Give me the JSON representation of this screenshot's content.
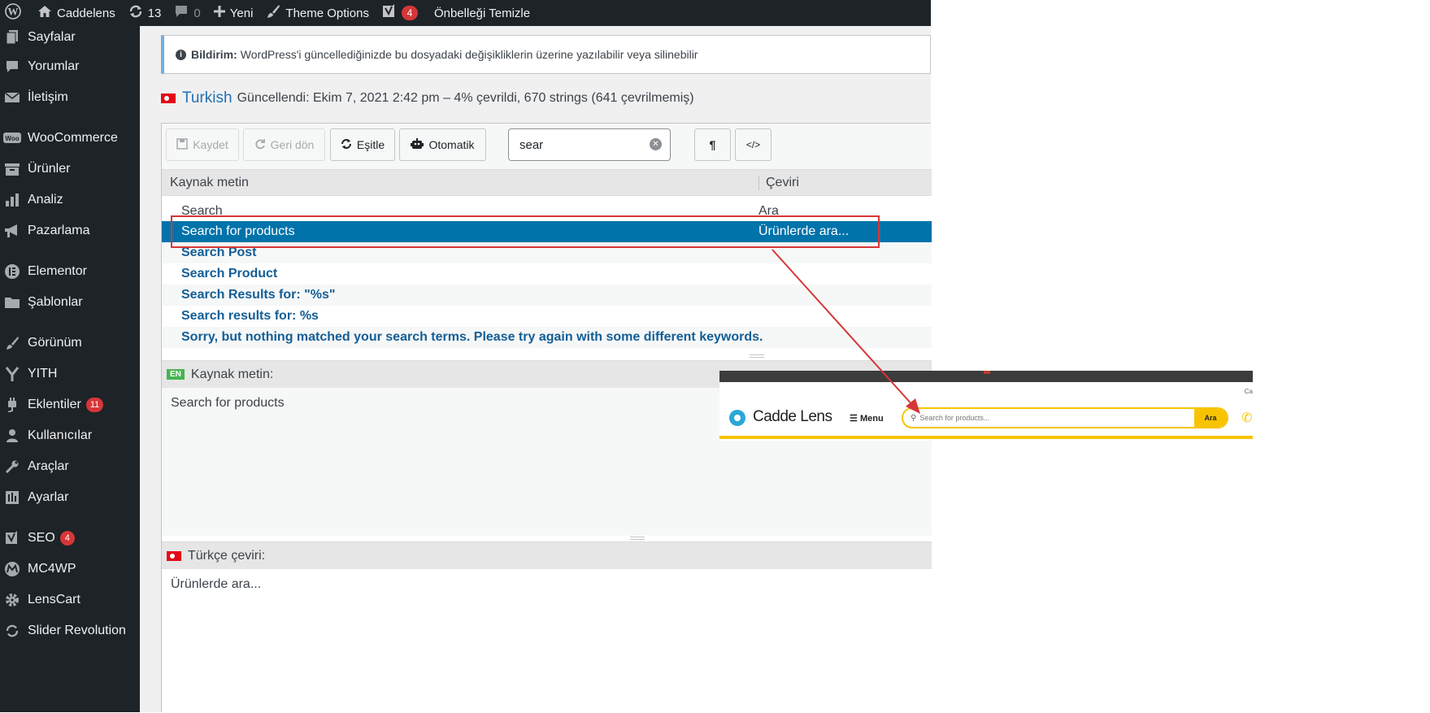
{
  "admin_bar": {
    "site_name": "Caddelens",
    "updates_count": "13",
    "comments_count": "0",
    "new_label": "Yeni",
    "theme_options_label": "Theme Options",
    "yoast_count": "4",
    "clear_cache_label": "Önbelleği Temizle"
  },
  "sidebar": {
    "items": [
      {
        "label": "Sayfalar",
        "icon": "pages-icon"
      },
      {
        "label": "Yorumlar",
        "icon": "comments-icon"
      },
      {
        "label": "İletişim",
        "icon": "mail-icon"
      },
      {
        "label": "WooCommerce",
        "icon": "woocommerce-icon"
      },
      {
        "label": "Ürünler",
        "icon": "archive-icon"
      },
      {
        "label": "Analiz",
        "icon": "bar-chart-icon"
      },
      {
        "label": "Pazarlama",
        "icon": "megaphone-icon"
      },
      {
        "label": "Elementor",
        "icon": "elementor-icon"
      },
      {
        "label": "Şablonlar",
        "icon": "folder-icon"
      },
      {
        "label": "Görünüm",
        "icon": "brush-icon"
      },
      {
        "label": "YITH",
        "icon": "yith-icon"
      },
      {
        "label": "Eklentiler",
        "icon": "plugin-icon",
        "badge": "11"
      },
      {
        "label": "Kullanıcılar",
        "icon": "user-icon"
      },
      {
        "label": "Araçlar",
        "icon": "wrench-icon"
      },
      {
        "label": "Ayarlar",
        "icon": "settings-icon"
      },
      {
        "label": "SEO",
        "icon": "yoast-icon",
        "badge": "4"
      },
      {
        "label": "MC4WP",
        "icon": "mc4wp-icon"
      },
      {
        "label": "LensCart",
        "icon": "gear-icon"
      },
      {
        "label": "Slider Revolution",
        "icon": "refresh-icon"
      }
    ]
  },
  "notice": {
    "title": "Bildirim:",
    "text": "WordPress'i güncellediğinizde bu dosyadaki değişikliklerin üzerine yazılabilir veya silinebilir"
  },
  "language": {
    "name": "Turkish",
    "status": "Güncellendi: Ekim 7, 2021 2:42 pm – 4% çevrildi, 670 strings (641 çevrilmemiş)"
  },
  "toolbar": {
    "save_label": "Kaydet",
    "revert_label": "Geri dön",
    "sync_label": "Eşitle",
    "auto_label": "Otomatik",
    "search_value": "sear",
    "pilcrow": "¶",
    "code_label": "</>"
  },
  "table": {
    "col_source": "Kaynak metin",
    "col_translation": "Çeviri",
    "rows": [
      {
        "source": "Search",
        "translation": "Ara"
      },
      {
        "source": "Search for products",
        "translation": "Ürünlerde ara..."
      },
      {
        "source": "Search Post",
        "translation": ""
      },
      {
        "source": "Search Product",
        "translation": ""
      },
      {
        "source": "Search Results for: \"%s\"",
        "translation": ""
      },
      {
        "source": "Search results for: %s",
        "translation": ""
      },
      {
        "source": "Sorry, but nothing matched your search terms. Please try again with some different keywords.",
        "translation": ""
      }
    ]
  },
  "source_pane": {
    "badge": "EN",
    "label": "Kaynak metin:",
    "text": "Search for products"
  },
  "translation_pane": {
    "label": "Türkçe çeviri:",
    "text": "Ürünlerde ara..."
  },
  "overlay": {
    "top_text": "Ca",
    "logo_text": "Cadde Lens",
    "menu_label": "Menu",
    "search_placeholder": "Search for products...",
    "search_button": "Ara"
  },
  "colors": {
    "admin_dark": "#1d2327",
    "selected_row": "#0073aa",
    "annotation_red": "#d63638",
    "brand_yellow": "#f8c300"
  }
}
